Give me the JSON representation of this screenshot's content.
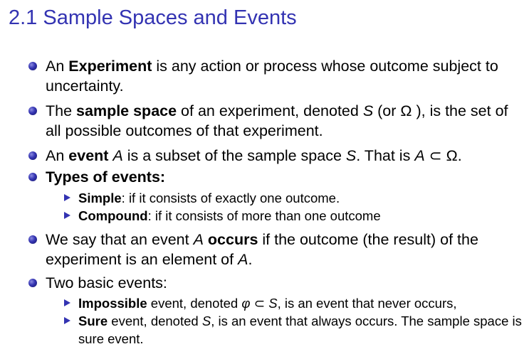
{
  "title": "2.1 Sample Spaces and Events",
  "items": {
    "experiment": {
      "pre": "An ",
      "bold": "Experiment",
      "post": " is any action or process whose outcome subject to uncertainty."
    },
    "sample_space": {
      "pre": "The ",
      "bold": "sample space",
      "mid1": " of an experiment, denoted ",
      "sym_s": "S",
      "mid2": " (or ",
      "sym_omega": "Ω",
      "post": " ), is the set of all possible outcomes of that experiment."
    },
    "event": {
      "pre": "An ",
      "bold": "event",
      "sym_a": "A",
      "mid1": " is a subset of the sample space ",
      "sym_s": "S",
      "mid2": ". That is ",
      "sym_a2": "A",
      "subset": "⊂",
      "sym_omega": "Ω",
      "post": "."
    },
    "types": {
      "bold": "Types of events:"
    },
    "occurs": {
      "pre": "We say that an event ",
      "sym_a": "A",
      "bold": "occurs",
      "mid": " if the outcome (the result) of the experiment is an element of ",
      "sym_a2": "A",
      "post": "."
    },
    "two_basic": {
      "text": "Two basic events:"
    }
  },
  "subitems": {
    "simple": {
      "bold": "Simple",
      "text": ": if it consists of exactly one outcome."
    },
    "compound": {
      "bold": "Compound",
      "text": ": if it consists of more than one outcome"
    },
    "impossible": {
      "bold": "Impossible",
      "mid1": " event, denoted ",
      "sym_phi": "φ",
      "subset": "⊂",
      "sym_s": "S",
      "post": ", is an event that never occurs,"
    },
    "sure": {
      "bold": "Sure",
      "mid1": " event, denoted ",
      "sym_s": "S",
      "post": ", is an event that always occurs. The sample space is sure event."
    }
  },
  "colors": {
    "title": "#3333b2",
    "bullet": "#3333b2",
    "text": "#000000"
  }
}
